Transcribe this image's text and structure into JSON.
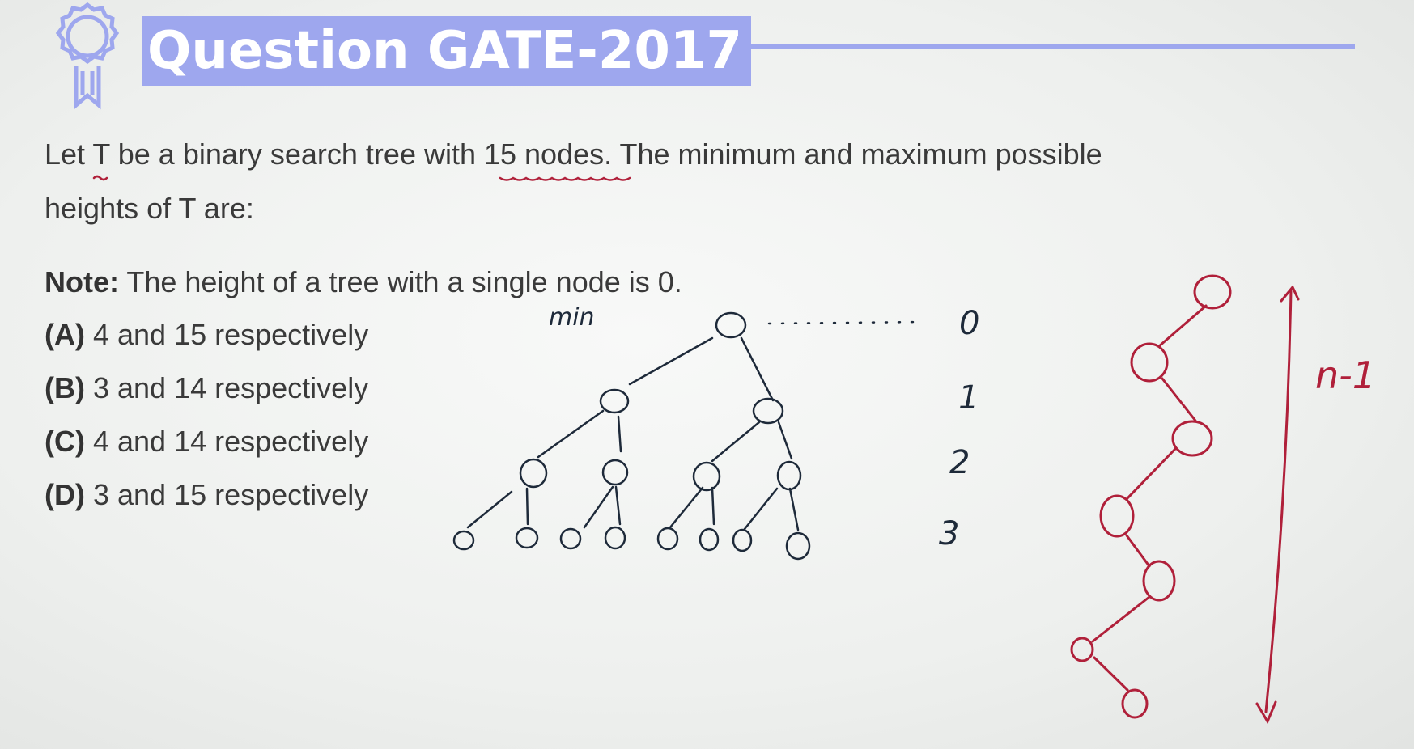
{
  "header": {
    "title": "Question GATE-2017"
  },
  "question": {
    "line1_a": "Let ",
    "line1_T": "T",
    "line1_b": " be a binary search tree with ",
    "line1_nodes": "15 nodes",
    "line1_c": ". The minimum and maximum possible",
    "line2": "heights of T are:",
    "note_label": "Note:",
    "note_text": " The height of a tree with a single node is 0."
  },
  "options": [
    {
      "label": "(A)",
      "text": " 4 and 15 respectively"
    },
    {
      "label": "(B)",
      "text": " 3 and 14 respectively"
    },
    {
      "label": "(C)",
      "text": " 4 and 14 respectively"
    },
    {
      "label": "(D)",
      "text": " 3 and 15 respectively"
    }
  ],
  "annotations": {
    "min_label": "min",
    "levels": [
      "0",
      "1",
      "2",
      "3"
    ],
    "max_height_label": "n-1"
  },
  "colors": {
    "title_bar": "#9ea7ee",
    "ink_black": "#1e2a3a",
    "ink_red": "#b0203a"
  }
}
